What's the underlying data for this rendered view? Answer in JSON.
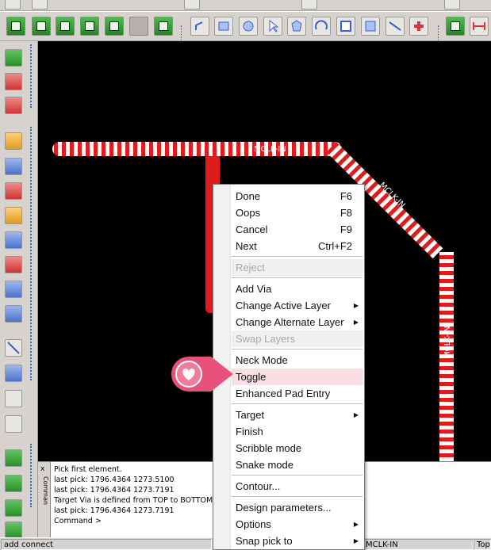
{
  "command_window": {
    "close_glyph": "x",
    "title": "Comman",
    "lines": [
      "Pick first element.",
      "last pick:  1796.4364 1273.5100",
      "last pick:  1796.4364 1273.7191",
      "Target Via is defined from TOP to BOTTOM",
      "last pick:  1796.4364 1273.7191",
      "Command >"
    ]
  },
  "status": {
    "mode": "add connect",
    "net": "MCLK-IN",
    "layer": "Top"
  },
  "canvas": {
    "net_labels": [
      "MCLK-IN",
      "MCLK-IN",
      "MCLK-IN"
    ],
    "trace_color": "#e01b1b",
    "background": "#000000"
  },
  "context_menu": {
    "items": [
      {
        "label": "Done",
        "shortcut": "F6"
      },
      {
        "label": "Oops",
        "shortcut": "F8"
      },
      {
        "label": "Cancel",
        "shortcut": "F9"
      },
      {
        "label": "Next",
        "shortcut": "Ctrl+F2"
      },
      {
        "label": "Reject",
        "disabled": true
      },
      {
        "label": "Add Via"
      },
      {
        "label": "Change Active Layer",
        "submenu": true
      },
      {
        "label": "Change Alternate Layer",
        "submenu": true
      },
      {
        "label": "Swap Layers",
        "disabled": true
      },
      {
        "label": "Neck Mode"
      },
      {
        "label": "Toggle",
        "highlighted": true
      },
      {
        "label": "Enhanced Pad Entry"
      },
      {
        "label": "Target",
        "submenu": true
      },
      {
        "label": "Finish"
      },
      {
        "label": "Scribble mode"
      },
      {
        "label": "Snake mode"
      },
      {
        "label": "Contour..."
      },
      {
        "label": "Design parameters..."
      },
      {
        "label": "Options",
        "submenu": true
      },
      {
        "label": "Snap pick to",
        "submenu": true
      }
    ]
  },
  "icons": {
    "toolbar": [
      "save-icon",
      "open-icon",
      "undo-icon",
      "redo-icon",
      "refresh-icon",
      "layer-icon",
      "window-icon",
      "line-icon",
      "rectangle-icon",
      "circle-icon",
      "select-arrow-icon",
      "polygon-icon",
      "arc-icon",
      "square-icon",
      "dimension-icon",
      "route-icon",
      "measure-icon"
    ],
    "pointer": "heart-pointer-icon"
  }
}
